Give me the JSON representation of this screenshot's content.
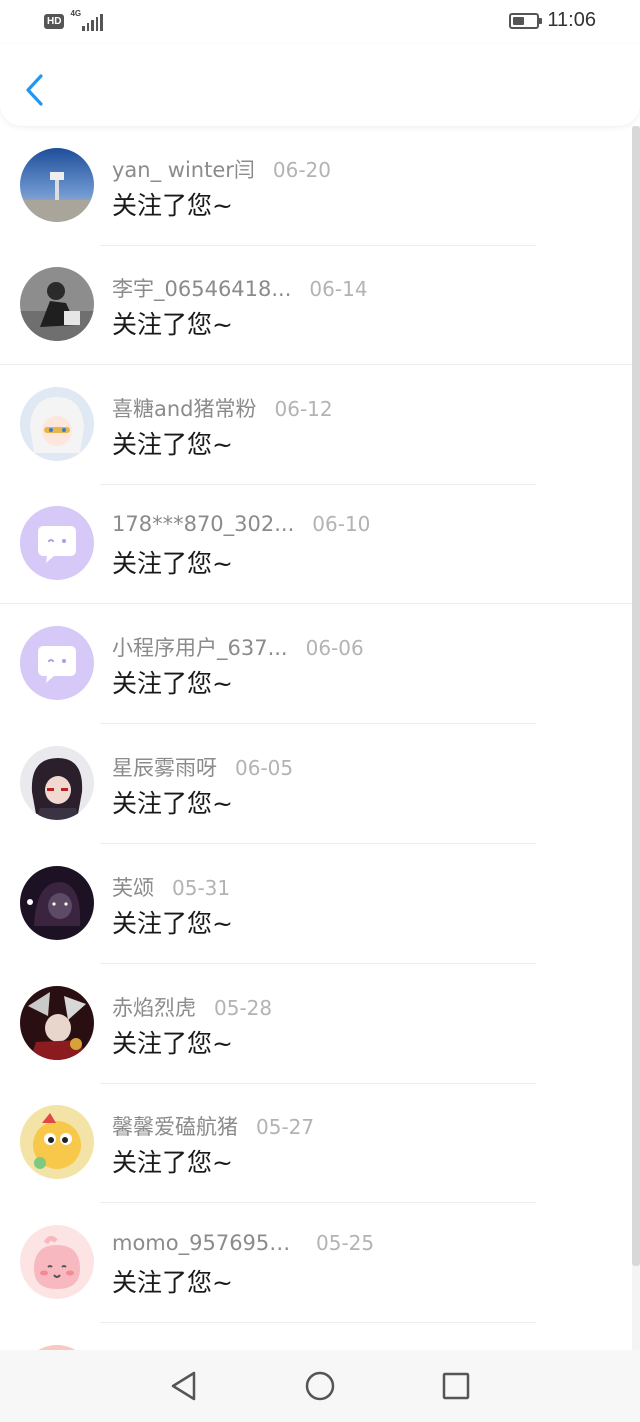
{
  "status_bar": {
    "network_badge": "HD",
    "network_type": "4G",
    "time": "11:06",
    "battery_level": 0.5
  },
  "header": {
    "back_icon": "chevron-left-icon",
    "accent_color": "#2196F3"
  },
  "notifications": [
    {
      "name": "yan_ winter闫",
      "date": "06-20",
      "message": "关注了您~"
    },
    {
      "name": "李宇_06546418...",
      "date": "06-14",
      "message": "关注了您~"
    },
    {
      "name": "喜糖and猪常粉",
      "date": "06-12",
      "message": "关注了您~"
    },
    {
      "name": "178***870_302...",
      "date": "06-10",
      "message": "关注了您~"
    },
    {
      "name": "小程序用户_637...",
      "date": "06-06",
      "message": "关注了您~"
    },
    {
      "name": "星辰雾雨呀",
      "date": "06-05",
      "message": "关注了您~"
    },
    {
      "name": "芙颂",
      "date": "05-31",
      "message": "关注了您~"
    },
    {
      "name": "赤焰烈虎",
      "date": "05-28",
      "message": "关注了您~"
    },
    {
      "name": "馨馨爱磕航猪",
      "date": "05-27",
      "message": "关注了您~"
    },
    {
      "name": "momo_9576950...",
      "date": "05-25",
      "message": "关注了您~"
    }
  ],
  "nav_bar": {
    "back_icon": "triangle-back-icon",
    "home_icon": "circle-home-icon",
    "recents_icon": "square-recents-icon"
  }
}
